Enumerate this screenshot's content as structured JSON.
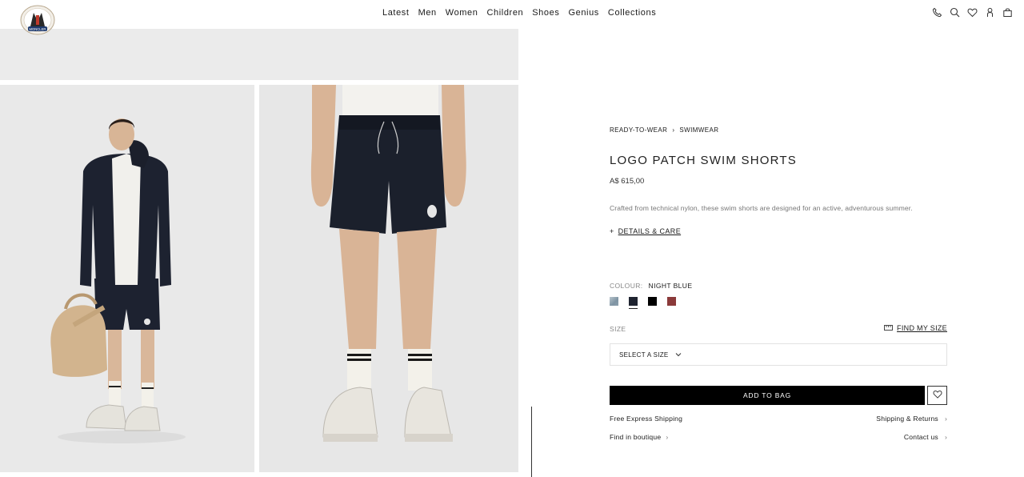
{
  "header": {
    "logo_text": "MONCLER",
    "nav": [
      "Latest",
      "Men",
      "Women",
      "Children",
      "Shoes",
      "Genius",
      "Collections"
    ],
    "icons": [
      "phone-icon",
      "search-icon",
      "heart-icon",
      "account-icon",
      "bag-icon"
    ]
  },
  "breadcrumb": {
    "parent": "READY-TO-WEAR",
    "separator": "›",
    "current": "SWIMWEAR"
  },
  "product": {
    "title": "LOGO PATCH SWIM SHORTS",
    "price": "A$ 615,00",
    "description": "Crafted from technical nylon, these swim shorts are designed for an active, adventurous summer.",
    "details_prefix": "+",
    "details_label": "DETAILS & CARE"
  },
  "colour": {
    "label": "COLOUR:",
    "selected": "NIGHT BLUE",
    "swatches": [
      {
        "name": "light-blue-grey",
        "color": "#8da0ad"
      },
      {
        "name": "night-blue",
        "color": "#1f2430",
        "selected": true
      },
      {
        "name": "black",
        "color": "#000000"
      },
      {
        "name": "red",
        "color": "#8b3a3a"
      }
    ]
  },
  "size": {
    "label": "SIZE",
    "find_size": "FIND MY SIZE",
    "select_label": "SELECT A SIZE",
    "caret": "⌄"
  },
  "actions": {
    "add_to_bag": "ADD TO BAG"
  },
  "links": {
    "free_shipping": "Free Express Shipping",
    "shipping_returns": "Shipping & Returns",
    "find_boutique": "Find in boutique",
    "contact": "Contact us",
    "chevron": "›"
  }
}
